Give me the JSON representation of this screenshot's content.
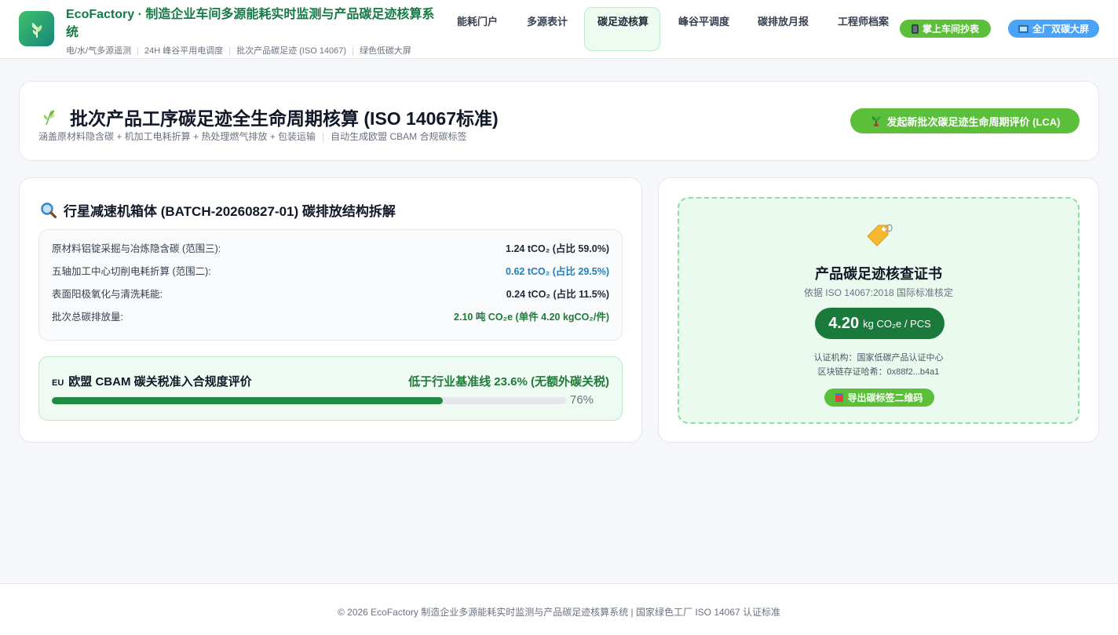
{
  "header": {
    "title": "EcoFactory · 制造企业车间多源能耗实时监测与产品碳足迹核算系统",
    "subtitle_items": [
      "电/水/气多源遥测",
      "24H 峰谷平用电调度",
      "批次产品碳足迹 (ISO 14067)",
      "绿色低碳大屏"
    ],
    "nav_tabs": [
      {
        "label": "能耗门户",
        "active": false
      },
      {
        "label": "多源表计",
        "active": false
      },
      {
        "label": "碳足迹核算",
        "active": true
      },
      {
        "label": "峰谷平调度",
        "active": false
      },
      {
        "label": "碳排放月报",
        "active": false
      },
      {
        "label": "工程师档案",
        "active": false
      }
    ],
    "mobile_button": "掌上车间抄表",
    "screen_button": "全厂双碳大屏"
  },
  "page": {
    "title": "批次产品工序碳足迹全生命周期核算 (ISO 14067标准)",
    "subtitle_left": "涵盖原材料隐含碳 + 机加工电耗折算 + 热处理燃气排放 + 包装运输",
    "subtitle_right": "自动生成欧盟 CBAM 合规碳标签",
    "lca_button": "发起新批次碳足迹生命周期评价 (LCA)"
  },
  "breakdown": {
    "title": "行星减速机箱体 (BATCH-20260827-01) 碳排放结构拆解",
    "rows": [
      {
        "label": "原材料铝锭采掘与冶炼隐含碳 (范围三):",
        "value": "1.24 tCO₂ (占比 59.0%)",
        "style": "normal"
      },
      {
        "label": "五轴加工中心切削电耗折算 (范围二):",
        "value": "0.62 tCO₂ (占比 29.5%)",
        "style": "blue"
      },
      {
        "label": "表面阳极氧化与清洗耗能:",
        "value": "0.24 tCO₂ (占比 11.5%)",
        "style": "normal"
      },
      {
        "label": "批次总碳排放量:",
        "value": "2.10 吨 CO₂e (单件 4.20 kgCO₂/件)",
        "style": "green"
      }
    ]
  },
  "cbam": {
    "badge": "EU",
    "title": "欧盟 CBAM 碳关税准入合规度评价",
    "status": "低于行业基准线 23.6% (无额外碳关税)",
    "progress": 0.76,
    "progress_label": "76%"
  },
  "certificate": {
    "title": "产品碳足迹核查证书",
    "standard": "依据 ISO 14067:2018 国际标准核定",
    "value": "4.20",
    "unit": "kg CO₂e / PCS",
    "authority": "认证机构：国家低碳产品认证中心",
    "hash": "区块链存证哈希：0x88f2...b4a1",
    "qr_button": "导出碳标签二维码"
  },
  "footer": {
    "text": "© 2026 EcoFactory 制造企业多源能耗实时监测与产品碳足迹核算系统 | 国家绿色工厂 ISO 14067 认证标准"
  },
  "colors": {
    "brand_green": "#157a45",
    "accent_green": "#5bbf3a",
    "accent_blue": "#4ba3f5",
    "value_blue": "#1f7fbf",
    "progress_green": "#1f8a42"
  },
  "icons": {
    "logo": "leaf-icon",
    "mobile": "phone-icon",
    "screen": "monitor-icon",
    "title": "sprout-icon",
    "lca": "seedling-icon",
    "breakdown": "magnifier-icon",
    "certificate": "tag-icon",
    "qr": "export-icon"
  }
}
